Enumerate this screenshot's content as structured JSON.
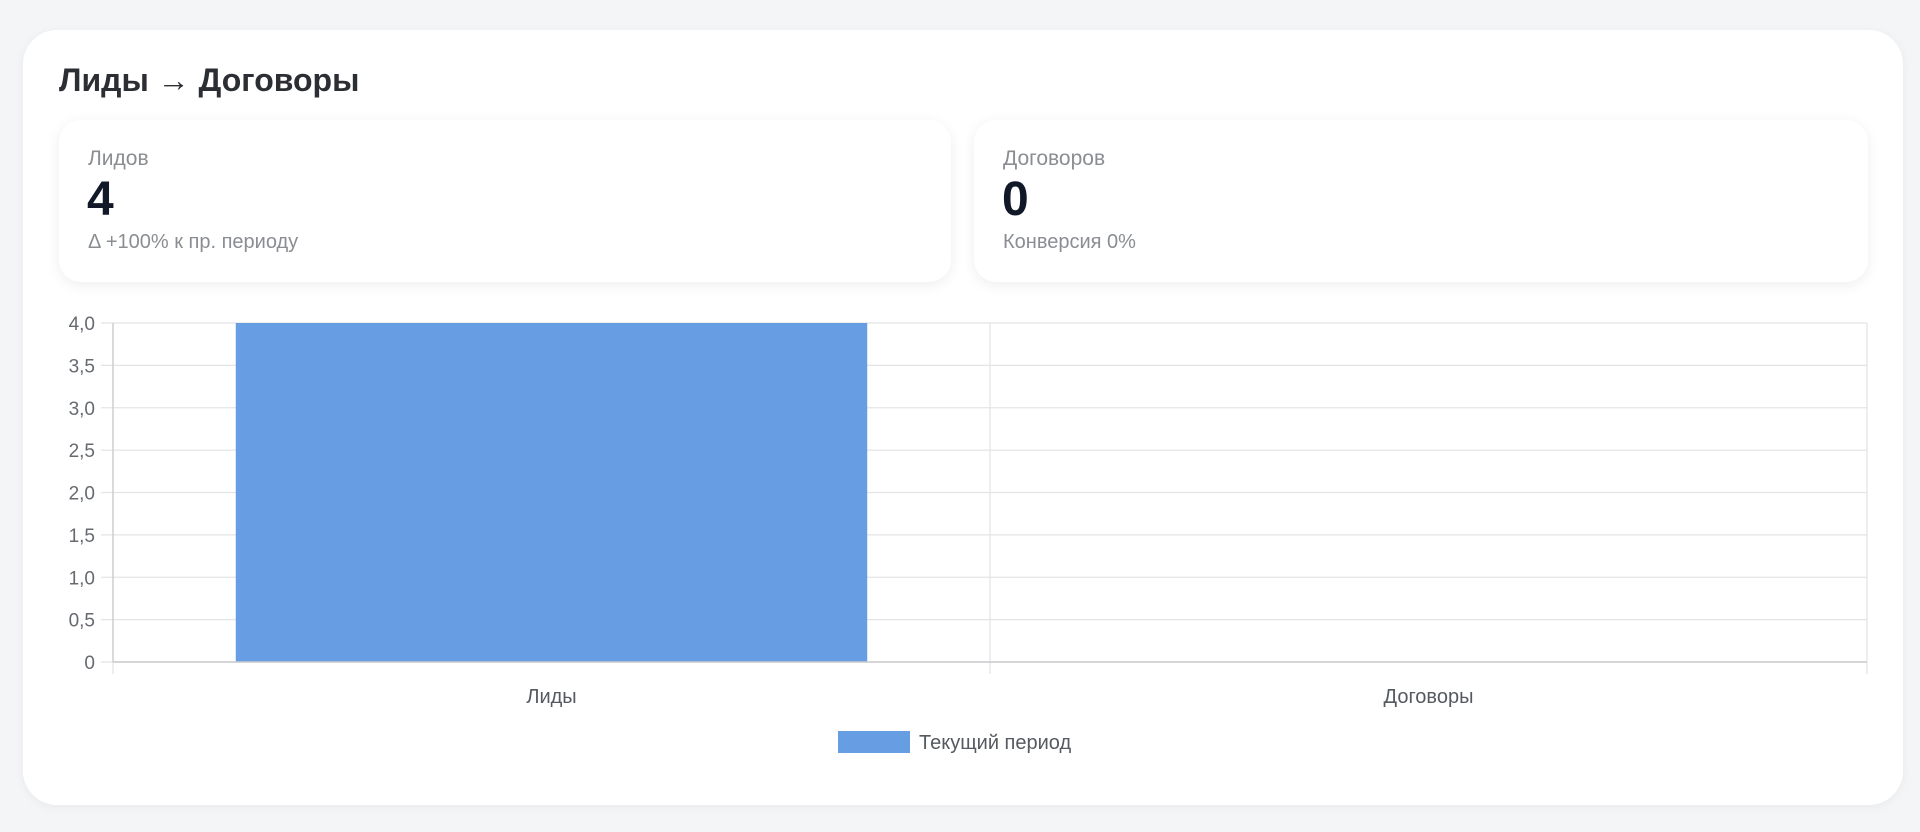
{
  "card": {
    "title": "Лиды → Договоры"
  },
  "kpis": [
    {
      "label": "Лидов",
      "value": "4",
      "sub": "Δ +100% к пр. периоду"
    },
    {
      "label": "Договоров",
      "value": "0",
      "sub": "Конверсия 0%"
    }
  ],
  "chart_data": {
    "type": "bar",
    "categories": [
      "Лиды",
      "Договоры"
    ],
    "series": [
      {
        "name": "Текущий период",
        "values": [
          4,
          0
        ],
        "color": "#669de3"
      }
    ],
    "ylim": [
      0,
      4
    ],
    "yticks": [
      "4,0",
      "3,5",
      "3,0",
      "2,5",
      "2,0",
      "1,5",
      "1,0",
      "0,5",
      "0"
    ],
    "grid": true,
    "legend_position": "bottom"
  }
}
